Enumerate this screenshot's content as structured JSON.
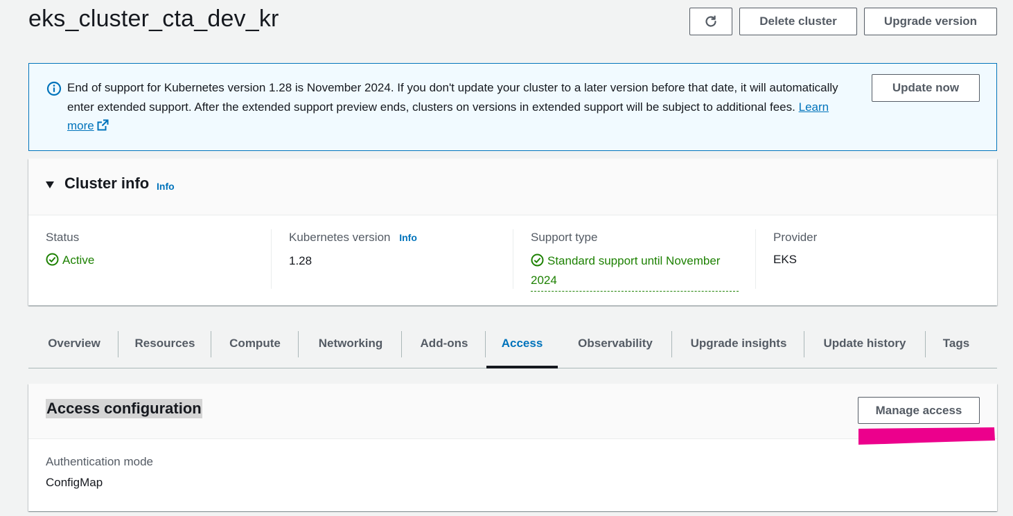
{
  "header": {
    "cluster_name": "eks_cluster_cta_dev_kr",
    "refresh_icon": "refresh-icon",
    "delete_label": "Delete cluster",
    "upgrade_label": "Upgrade version"
  },
  "alert": {
    "icon": "info-circle-icon",
    "message": "End of support for Kubernetes version 1.28 is November 2024. If you don't update your cluster to a later version before that date, it will automatically enter extended support. After the extended support preview ends, clusters on versions in extended support will be subject to additional fees.",
    "link_label": "Learn more",
    "link_icon": "external-link-icon",
    "button_label": "Update now"
  },
  "cluster_info": {
    "title": "Cluster info",
    "info_link": "Info",
    "status_label": "Status",
    "status_value": "Active",
    "k8s_label": "Kubernetes version",
    "k8s_info_link": "Info",
    "k8s_value": "1.28",
    "support_label": "Support type",
    "support_value": "Standard support until November 2024",
    "provider_label": "Provider",
    "provider_value": "EKS"
  },
  "tabs": [
    {
      "label": "Overview"
    },
    {
      "label": "Resources"
    },
    {
      "label": "Compute"
    },
    {
      "label": "Networking"
    },
    {
      "label": "Add-ons"
    },
    {
      "label": "Access",
      "active": true
    },
    {
      "label": "Observability"
    },
    {
      "label": "Upgrade insights"
    },
    {
      "label": "Update history"
    },
    {
      "label": "Tags"
    }
  ],
  "access": {
    "title": "Access configuration",
    "manage_label": "Manage access",
    "auth_mode_label": "Authentication mode",
    "auth_mode_value": "ConfigMap"
  },
  "colors": {
    "accent": "#0073bb",
    "success": "#1d8102",
    "highlight_stroke": "#ec008c"
  }
}
